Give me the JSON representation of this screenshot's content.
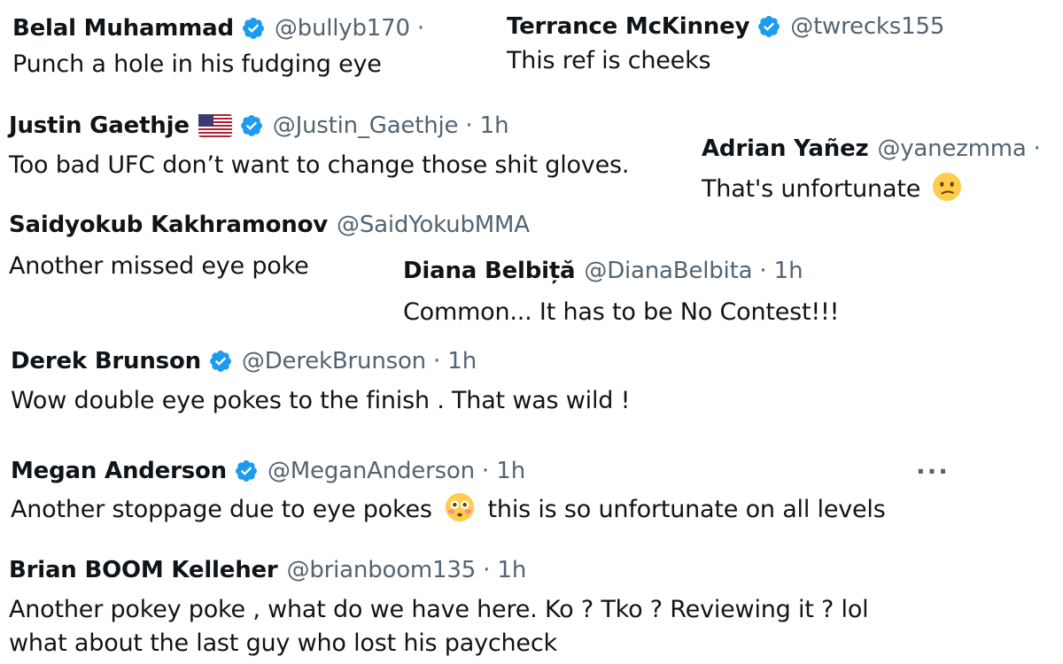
{
  "colors": {
    "text": "#0f1419",
    "muted": "#536471",
    "verified_blue": "#1d9bf0"
  },
  "tweets": [
    {
      "name": "Belal Muhammad",
      "verified": true,
      "handle": "@bullyb170",
      "separator": "·",
      "time": "",
      "text": "Punch a hole in his fudging eye"
    },
    {
      "name": "Terrance McKinney",
      "verified": true,
      "handle": "@twrecks155",
      "separator": "",
      "time": "",
      "text": "This ref is cheeks"
    },
    {
      "name": "Justin Gaethje",
      "verified": true,
      "flag": "us-flag-icon",
      "handle": "@Justin_Gaethje",
      "separator": "·",
      "time": "1h",
      "text": "Too bad UFC don’t want to change those shit gloves."
    },
    {
      "name": "Adrian Yañez",
      "verified": false,
      "handle": "@yanezmma",
      "separator": "·",
      "time": "",
      "text": "That's unfortunate",
      "emoji": "confused-face-emoji"
    },
    {
      "name": "Saidyokub Kakhramonov",
      "verified": false,
      "handle": "@SaidYokubMMA",
      "separator": "",
      "time": "",
      "text": "Another missed eye poke"
    },
    {
      "name": "Diana Belbiță",
      "verified": false,
      "handle": "@DianaBelbita",
      "separator": "·",
      "time": "1h",
      "text": "Common... It has to be No Contest!!!"
    },
    {
      "name": "Derek Brunson",
      "verified": true,
      "handle": "@DerekBrunson",
      "separator": "·",
      "time": "1h",
      "text": "Wow double eye pokes to the finish . That was wild !"
    },
    {
      "name": "Megan Anderson",
      "verified": true,
      "handle": "@MeganAnderson",
      "separator": "·",
      "time": "1h",
      "text_before": "Another stoppage due to eye pokes",
      "emoji": "flushed-face-emoji",
      "text_after": "this is so unfortunate on all levels",
      "more": "···"
    },
    {
      "name": "Brian BOOM Kelleher",
      "verified": false,
      "handle": "@brianboom135",
      "separator": "·",
      "time": "1h",
      "text_line1": "Another pokey poke , what do we have here. Ko ? Tko ? Reviewing it ? lol",
      "text_line2": "what about the last guy who lost his paycheck"
    }
  ]
}
